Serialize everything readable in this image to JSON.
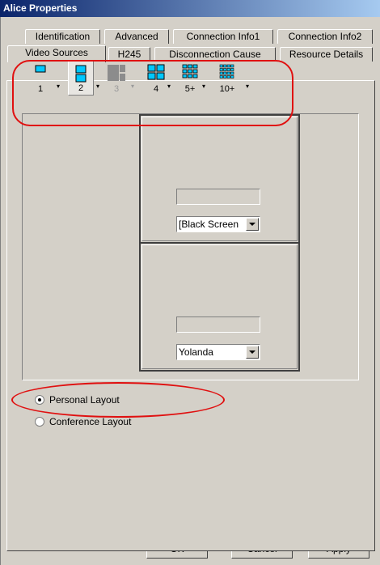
{
  "window": {
    "title": "Alice Properties"
  },
  "tabs": {
    "row1": [
      "Identification",
      "Advanced",
      "Connection Info1",
      "Connection Info2"
    ],
    "row2": [
      "Video Sources",
      "H245",
      "Disconnection Cause",
      "Resource Details"
    ],
    "active": "Video Sources"
  },
  "layout_toolbar": {
    "buttons": [
      {
        "label": "1",
        "icon": "single-screen-icon",
        "selected": false,
        "disabled": false
      },
      {
        "label": "2",
        "icon": "two-screen-icon",
        "selected": true,
        "disabled": false
      },
      {
        "label": "3",
        "icon": "three-screen-icon",
        "selected": false,
        "disabled": true
      },
      {
        "label": "4",
        "icon": "four-screen-icon",
        "selected": false,
        "disabled": false
      },
      {
        "label": "5+",
        "icon": "nine-screen-icon",
        "selected": false,
        "disabled": false
      },
      {
        "label": "10+",
        "icon": "sixteen-screen-icon",
        "selected": false,
        "disabled": false
      }
    ]
  },
  "video_cells": [
    {
      "source": "[Black Screen"
    },
    {
      "source": "Yolanda"
    }
  ],
  "layout_mode": {
    "options": [
      "Personal Layout",
      "Conference Layout"
    ],
    "selected": "Personal Layout"
  },
  "buttons": {
    "ok": "OK",
    "cancel": "Cancel",
    "apply": "Apply"
  },
  "colors": {
    "annotation": "#e01010",
    "icon_fill": "#00c8ff",
    "title_bar": "#0a246a"
  }
}
